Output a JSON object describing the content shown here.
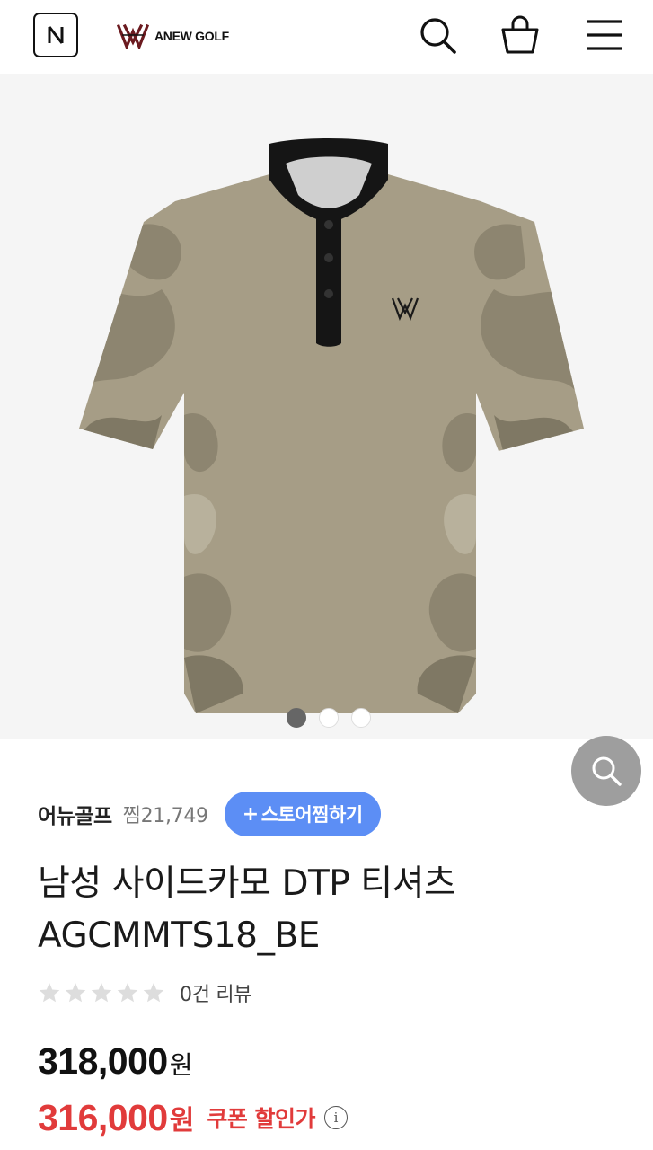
{
  "header": {
    "n_icon": "naver-n-icon",
    "brand_text": "ANEW GOLF",
    "icons": [
      "search-icon",
      "shopping-bag-icon",
      "menu-icon"
    ]
  },
  "gallery": {
    "image_count": 3,
    "active_index": 0,
    "zoom_icon": "zoom-icon",
    "shirt_colors": {
      "base": "#a69d86",
      "camo_dark": "#8d8570",
      "camo_light": "#b8b19c",
      "collar": "#151515"
    }
  },
  "store": {
    "name": "어뉴골프",
    "zzim": "찜21,749",
    "fav_plus": "+",
    "fav_label": "스토어찜하기",
    "fav_color": "#5c8ef5"
  },
  "product": {
    "title": "남성 사이드카모 DTP 티셔츠 AGCMMTS18_BE",
    "rating_stars": 0,
    "rating_max": 5,
    "review_text": "0건 리뷰"
  },
  "price": {
    "original": "318,000",
    "original_unit": "원",
    "sale": "316,000",
    "sale_unit": "원",
    "coupon_text": "쿠폰 할인가",
    "info_glyph": "i",
    "sale_color": "#e13b3b"
  }
}
